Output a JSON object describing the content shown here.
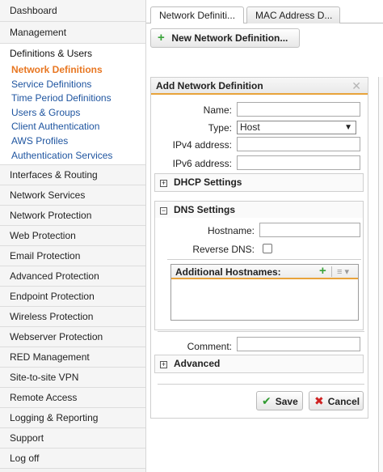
{
  "sidebar": {
    "items_top": [
      {
        "label": "Dashboard"
      },
      {
        "label": "Management"
      }
    ],
    "section": {
      "title": "Definitions & Users",
      "items": [
        {
          "label": "Network Definitions",
          "active": true
        },
        {
          "label": "Service Definitions"
        },
        {
          "label": "Time Period Definitions"
        },
        {
          "label": "Users & Groups"
        },
        {
          "label": "Client Authentication"
        },
        {
          "label": "AWS Profiles"
        },
        {
          "label": "Authentication Services"
        }
      ]
    },
    "items_bottom": [
      {
        "label": "Interfaces & Routing"
      },
      {
        "label": "Network Services"
      },
      {
        "label": "Network Protection"
      },
      {
        "label": "Web Protection"
      },
      {
        "label": "Email Protection"
      },
      {
        "label": "Advanced Protection"
      },
      {
        "label": "Endpoint Protection"
      },
      {
        "label": "Wireless Protection"
      },
      {
        "label": "Webserver Protection"
      },
      {
        "label": "RED Management"
      },
      {
        "label": "Site-to-site VPN"
      },
      {
        "label": "Remote Access"
      },
      {
        "label": "Logging & Reporting"
      },
      {
        "label": "Support"
      },
      {
        "label": "Log off"
      }
    ]
  },
  "tabs": [
    {
      "label": "Network Definiti..."
    },
    {
      "label": "MAC Address D..."
    }
  ],
  "toolbar": {
    "new_label": "New Network Definition..."
  },
  "dialog": {
    "title": "Add Network Definition",
    "close_glyph": "✕",
    "fields": {
      "name_label": "Name:",
      "name_value": "",
      "type_label": "Type:",
      "type_value": "Host",
      "ipv4_label": "IPv4 address:",
      "ipv4_value": "",
      "ipv6_label": "IPv6 address:",
      "ipv6_value": ""
    },
    "dhcp": {
      "title": "DHCP Settings",
      "expander": "+"
    },
    "dns": {
      "title": "DNS Settings",
      "expander": "−",
      "hostname_label": "Hostname:",
      "hostname_value": "",
      "reverse_dns_label": "Reverse DNS:",
      "reverse_dns_checked": false,
      "additional_title": "Additional Hostnames:"
    },
    "comment_label": "Comment:",
    "comment_value": "",
    "advanced": {
      "title": "Advanced",
      "expander": "+"
    },
    "save_label": "Save",
    "cancel_label": "Cancel"
  },
  "colors": {
    "accent_orange": "#e87722",
    "link_blue": "#1f55a0",
    "header_underline": "#e8a33b",
    "add_green": "#3aa33a",
    "cancel_red": "#cf2222"
  },
  "icons": [
    "plus-icon",
    "close-icon",
    "chevron-down-icon",
    "expand-icon",
    "collapse-icon",
    "list-icon",
    "check-icon",
    "x-icon"
  ]
}
